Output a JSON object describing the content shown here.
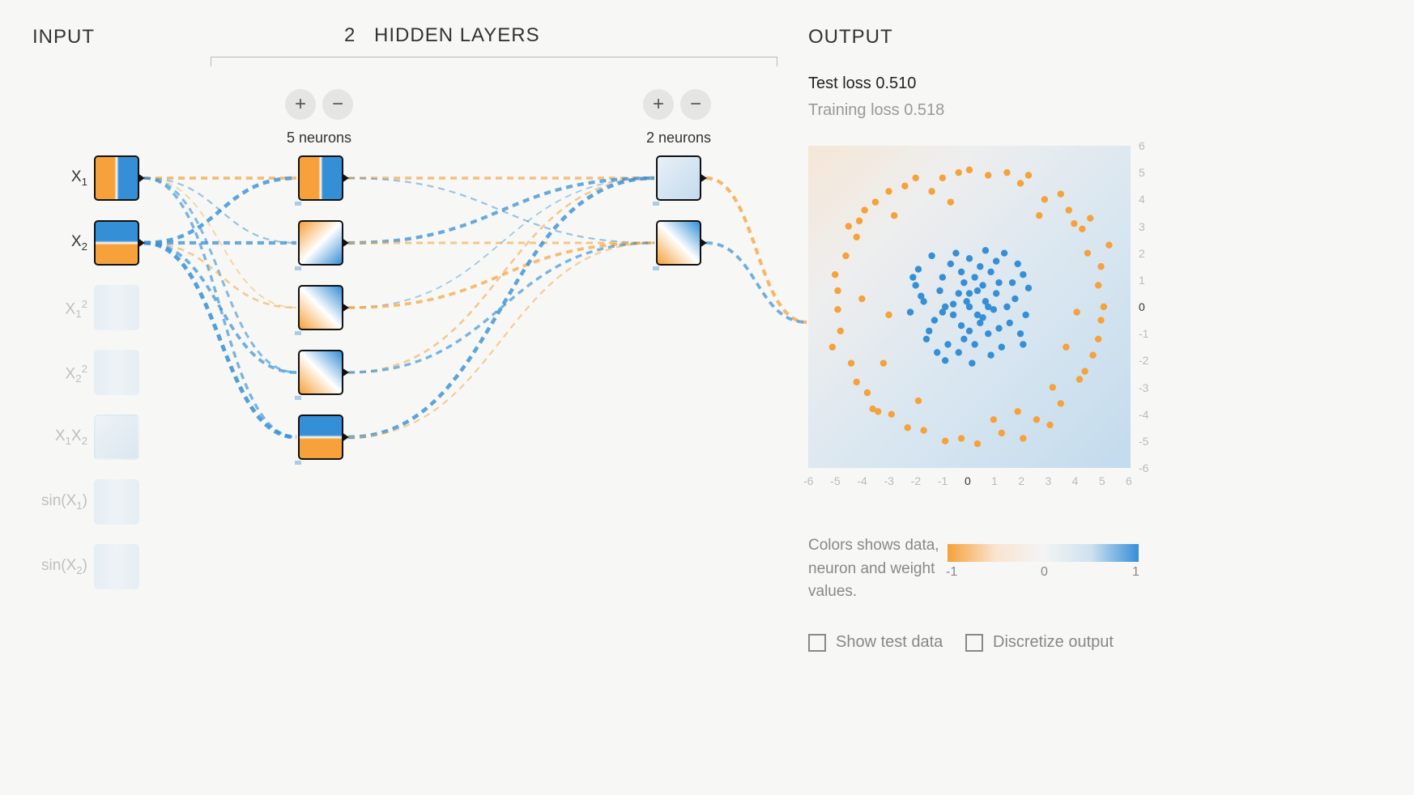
{
  "sections": {
    "input": "INPUT",
    "hidden": "HIDDEN LAYERS",
    "output": "OUTPUT"
  },
  "hidden_layer_count": "2",
  "layers": [
    {
      "neurons": 5,
      "label": "5 neurons",
      "add": "+",
      "remove": "−"
    },
    {
      "neurons": 2,
      "label": "2 neurons",
      "add": "+",
      "remove": "−"
    }
  ],
  "features": [
    {
      "id": "x1",
      "label_html": "X<sub>1</sub>",
      "enabled": true
    },
    {
      "id": "x2",
      "label_html": "X<sub>2</sub>",
      "enabled": true
    },
    {
      "id": "x1sq",
      "label_html": "X<sub>1</sub><sup>2</sup>",
      "enabled": false
    },
    {
      "id": "x2sq",
      "label_html": "X<sub>2</sub><sup>2</sup>",
      "enabled": false
    },
    {
      "id": "x1x2",
      "label_html": "X<sub>1</sub>X<sub>2</sub>",
      "enabled": false
    },
    {
      "id": "sinx1",
      "label_html": "sin(X<sub>1</sub>)",
      "enabled": false
    },
    {
      "id": "sinx2",
      "label_html": "sin(X<sub>2</sub>)",
      "enabled": false
    }
  ],
  "loss": {
    "test_label": "Test loss",
    "test": "0.510",
    "train_label": "Training loss",
    "train": "0.518"
  },
  "legend": {
    "text": "Colors shows data, neuron and weight values.",
    "min": "-1",
    "mid": "0",
    "max": "1"
  },
  "checkboxes": {
    "show_test": "Show test data",
    "discretize": "Discretize output"
  },
  "colors": {
    "pos": "#358fd6",
    "neg": "#f6a13a"
  },
  "chart_data": {
    "type": "scatter",
    "xlim": [
      -6,
      6
    ],
    "ylim": [
      -6,
      6
    ],
    "xticks": [
      -6,
      -5,
      -4,
      -3,
      -2,
      -1,
      0,
      1,
      2,
      3,
      4,
      5,
      6
    ],
    "yticks": [
      -6,
      -5,
      -4,
      -3,
      -2,
      -1,
      0,
      1,
      2,
      3,
      4,
      5,
      6
    ],
    "series": [
      {
        "name": "class_pos",
        "color": "#358fd6",
        "points": [
          [
            -0.1,
            0.2
          ],
          [
            0.3,
            0.6
          ],
          [
            -0.6,
            0.1
          ],
          [
            0.5,
            -0.4
          ],
          [
            -0.3,
            -0.7
          ],
          [
            1.1,
            0.9
          ],
          [
            0.8,
            1.3
          ],
          [
            -1.0,
            1.1
          ],
          [
            -1.3,
            -0.5
          ],
          [
            0.2,
            -1.4
          ],
          [
            1.5,
            -0.6
          ],
          [
            -0.7,
            1.6
          ],
          [
            0.0,
            1.8
          ],
          [
            1.7,
            0.3
          ],
          [
            -1.8,
            0.4
          ],
          [
            -0.4,
            -1.7
          ],
          [
            1.2,
            -1.5
          ],
          [
            -1.6,
            -1.2
          ],
          [
            2.0,
            1.2
          ],
          [
            0.6,
            2.1
          ],
          [
            -2.0,
            0.8
          ],
          [
            -0.9,
            -2.0
          ],
          [
            2.1,
            -0.3
          ],
          [
            -0.2,
            0.9
          ],
          [
            0.9,
            -0.1
          ],
          [
            -1.1,
            0.6
          ],
          [
            0.4,
            1.5
          ],
          [
            1.4,
            0.0
          ],
          [
            -1.5,
            -0.9
          ],
          [
            0.7,
            -1.0
          ],
          [
            -0.5,
            2.0
          ],
          [
            2.2,
            0.7
          ],
          [
            -2.2,
            -0.2
          ],
          [
            0.1,
            -2.1
          ],
          [
            1.8,
            1.6
          ],
          [
            -1.9,
            1.4
          ],
          [
            1.3,
            2.0
          ],
          [
            -0.8,
            -1.4
          ],
          [
            0.3,
            -0.3
          ],
          [
            0.0,
            0.0
          ],
          [
            0.6,
            0.2
          ],
          [
            -0.4,
            0.5
          ],
          [
            0.2,
            1.1
          ],
          [
            -1.2,
            -1.7
          ],
          [
            1.9,
            -1.0
          ],
          [
            0.0,
            -0.9
          ],
          [
            -0.9,
            0.0
          ],
          [
            1.0,
            0.5
          ],
          [
            -0.3,
            1.3
          ],
          [
            0.5,
            0.8
          ],
          [
            -0.6,
            -0.3
          ],
          [
            1.6,
            0.9
          ],
          [
            -1.4,
            1.9
          ],
          [
            0.8,
            -1.8
          ],
          [
            -1.7,
            0.2
          ],
          [
            2.0,
            -1.4
          ],
          [
            1.1,
            -0.8
          ],
          [
            -2.1,
            1.1
          ],
          [
            0.4,
            -0.6
          ],
          [
            -0.2,
            -1.2
          ],
          [
            1.0,
            1.7
          ],
          [
            -1.0,
            -0.2
          ],
          [
            0.7,
            0.0
          ],
          [
            0.0,
            0.5
          ]
        ]
      },
      {
        "name": "class_neg",
        "color": "#f6a13a",
        "points": [
          [
            -4.1,
            3.2
          ],
          [
            -3.5,
            3.9
          ],
          [
            -2.4,
            4.5
          ],
          [
            -1.0,
            4.8
          ],
          [
            0.7,
            4.9
          ],
          [
            1.9,
            4.6
          ],
          [
            2.8,
            4.0
          ],
          [
            3.4,
            4.2
          ],
          [
            3.9,
            3.1
          ],
          [
            4.4,
            2.0
          ],
          [
            4.8,
            0.8
          ],
          [
            4.9,
            -0.5
          ],
          [
            4.6,
            -1.8
          ],
          [
            4.1,
            -2.7
          ],
          [
            3.4,
            -3.6
          ],
          [
            2.5,
            -4.2
          ],
          [
            1.2,
            -4.7
          ],
          [
            -0.3,
            -4.9
          ],
          [
            -1.7,
            -4.6
          ],
          [
            -2.9,
            -4.0
          ],
          [
            -3.8,
            -3.2
          ],
          [
            -4.4,
            -2.1
          ],
          [
            -4.8,
            -0.9
          ],
          [
            -4.9,
            0.6
          ],
          [
            -4.6,
            1.9
          ],
          [
            -4.2,
            2.6
          ],
          [
            -3.0,
            4.3
          ],
          [
            0.0,
            5.1
          ],
          [
            2.2,
            4.9
          ],
          [
            4.2,
            2.9
          ],
          [
            5.0,
            0.0
          ],
          [
            4.3,
            -2.4
          ],
          [
            2.0,
            -4.9
          ],
          [
            -0.9,
            -5.0
          ],
          [
            -3.6,
            -3.8
          ],
          [
            -4.9,
            -0.1
          ],
          [
            -3.9,
            3.6
          ],
          [
            1.4,
            5.0
          ],
          [
            3.7,
            3.6
          ],
          [
            4.9,
            1.5
          ],
          [
            4.8,
            -1.2
          ],
          [
            3.0,
            -4.4
          ],
          [
            0.3,
            -5.1
          ],
          [
            -2.3,
            -4.5
          ],
          [
            -4.2,
            -2.8
          ],
          [
            -5.0,
            1.2
          ],
          [
            -2.0,
            4.8
          ],
          [
            -0.4,
            5.0
          ],
          [
            3.1,
            -3.0
          ],
          [
            -3.2,
            -2.1
          ],
          [
            5.2,
            2.3
          ],
          [
            -4.5,
            3.0
          ],
          [
            -5.1,
            -1.5
          ],
          [
            1.8,
            -3.9
          ],
          [
            -1.4,
            4.3
          ],
          [
            4.0,
            -0.2
          ],
          [
            -2.8,
            3.4
          ],
          [
            2.6,
            3.4
          ],
          [
            -3.4,
            -3.9
          ],
          [
            0.9,
            -4.2
          ],
          [
            -4.0,
            0.3
          ],
          [
            3.6,
            -1.5
          ],
          [
            -1.9,
            -3.5
          ],
          [
            4.5,
            3.3
          ],
          [
            -0.7,
            3.9
          ],
          [
            -3.0,
            -0.3
          ]
        ]
      }
    ]
  },
  "connections": [
    {
      "from": "in0",
      "to": "h0_0",
      "w": 0.7,
      "sign": "neg"
    },
    {
      "from": "in0",
      "to": "h0_1",
      "w": 0.3,
      "sign": "pos"
    },
    {
      "from": "in0",
      "to": "h0_2",
      "w": 0.2,
      "sign": "neg"
    },
    {
      "from": "in0",
      "to": "h0_3",
      "w": 0.5,
      "sign": "pos"
    },
    {
      "from": "in0",
      "to": "h0_4",
      "w": 0.6,
      "sign": "pos"
    },
    {
      "from": "in1",
      "to": "h0_0",
      "w": 0.9,
      "sign": "pos"
    },
    {
      "from": "in1",
      "to": "h0_1",
      "w": 0.8,
      "sign": "pos"
    },
    {
      "from": "in1",
      "to": "h0_2",
      "w": 0.4,
      "sign": "neg"
    },
    {
      "from": "in1",
      "to": "h0_3",
      "w": 0.7,
      "sign": "pos"
    },
    {
      "from": "in1",
      "to": "h0_4",
      "w": 1.0,
      "sign": "pos"
    },
    {
      "from": "h0_0",
      "to": "h1_0",
      "w": 0.6,
      "sign": "neg"
    },
    {
      "from": "h0_0",
      "to": "h1_1",
      "w": 0.3,
      "sign": "pos"
    },
    {
      "from": "h0_1",
      "to": "h1_0",
      "w": 0.8,
      "sign": "pos"
    },
    {
      "from": "h0_1",
      "to": "h1_1",
      "w": 0.5,
      "sign": "neg"
    },
    {
      "from": "h0_2",
      "to": "h1_0",
      "w": 0.2,
      "sign": "pos"
    },
    {
      "from": "h0_2",
      "to": "h1_1",
      "w": 0.7,
      "sign": "neg"
    },
    {
      "from": "h0_3",
      "to": "h1_0",
      "w": 0.4,
      "sign": "neg"
    },
    {
      "from": "h0_3",
      "to": "h1_1",
      "w": 0.6,
      "sign": "pos"
    },
    {
      "from": "h0_4",
      "to": "h1_0",
      "w": 0.9,
      "sign": "pos"
    },
    {
      "from": "h0_4",
      "to": "h1_1",
      "w": 0.3,
      "sign": "neg"
    },
    {
      "from": "h1_0",
      "to": "out",
      "w": 0.8,
      "sign": "neg"
    },
    {
      "from": "h1_1",
      "to": "out",
      "w": 0.7,
      "sign": "pos"
    }
  ]
}
